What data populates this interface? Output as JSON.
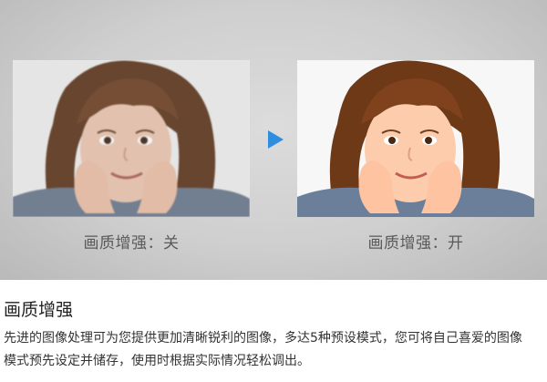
{
  "comparison": {
    "before_caption": "画质增强：关",
    "after_caption": "画质增强：开",
    "arrow_icon": "play-arrow-icon",
    "arrow_color": "#2f8ddf"
  },
  "feature": {
    "title": "画质增强",
    "description": "先进的图像处理可为您提供更加清晰锐利的图像，多达5种预设模式，您可将自己喜爱的图像模式预先设定并储存，使用时根据实际情况轻松调出。"
  }
}
